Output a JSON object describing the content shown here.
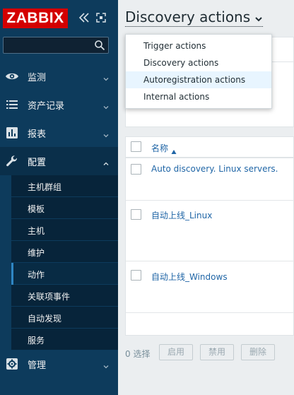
{
  "brand": {
    "logo_text": "ZABBIX",
    "accent": "#d40000",
    "sidebar_bg": "#0d3b5c"
  },
  "search": {
    "placeholder": "",
    "value": ""
  },
  "menu": {
    "items": [
      {
        "label": "监测",
        "icon": "eye-icon"
      },
      {
        "label": "资产记录",
        "icon": "list-icon"
      },
      {
        "label": "报表",
        "icon": "bar-chart-icon"
      },
      {
        "label": "配置",
        "icon": "wrench-icon",
        "expanded": true
      },
      {
        "label": "管理",
        "icon": "gear-icon"
      }
    ],
    "config_submenu": [
      {
        "label": "主机群组"
      },
      {
        "label": "模板"
      },
      {
        "label": "主机"
      },
      {
        "label": "维护"
      },
      {
        "label": "动作",
        "active": true
      },
      {
        "label": "关联项事件"
      },
      {
        "label": "自动发现"
      },
      {
        "label": "服务"
      }
    ]
  },
  "page": {
    "title": "Discovery actions"
  },
  "dropdown": {
    "items": [
      {
        "label": "Trigger actions"
      },
      {
        "label": "Discovery actions"
      },
      {
        "label": "Autoregistration actions",
        "highlighted": true
      },
      {
        "label": "Internal actions"
      }
    ]
  },
  "table": {
    "header_name": "名称",
    "rows": [
      {
        "name": "Auto discovery. Linux servers."
      },
      {
        "name": "自动上线_Linux"
      },
      {
        "name": "自动上线_Windows"
      }
    ]
  },
  "footer": {
    "selected_text": "0 选择",
    "enable_label": "启用",
    "disable_label": "禁用",
    "delete_label": "删除"
  }
}
